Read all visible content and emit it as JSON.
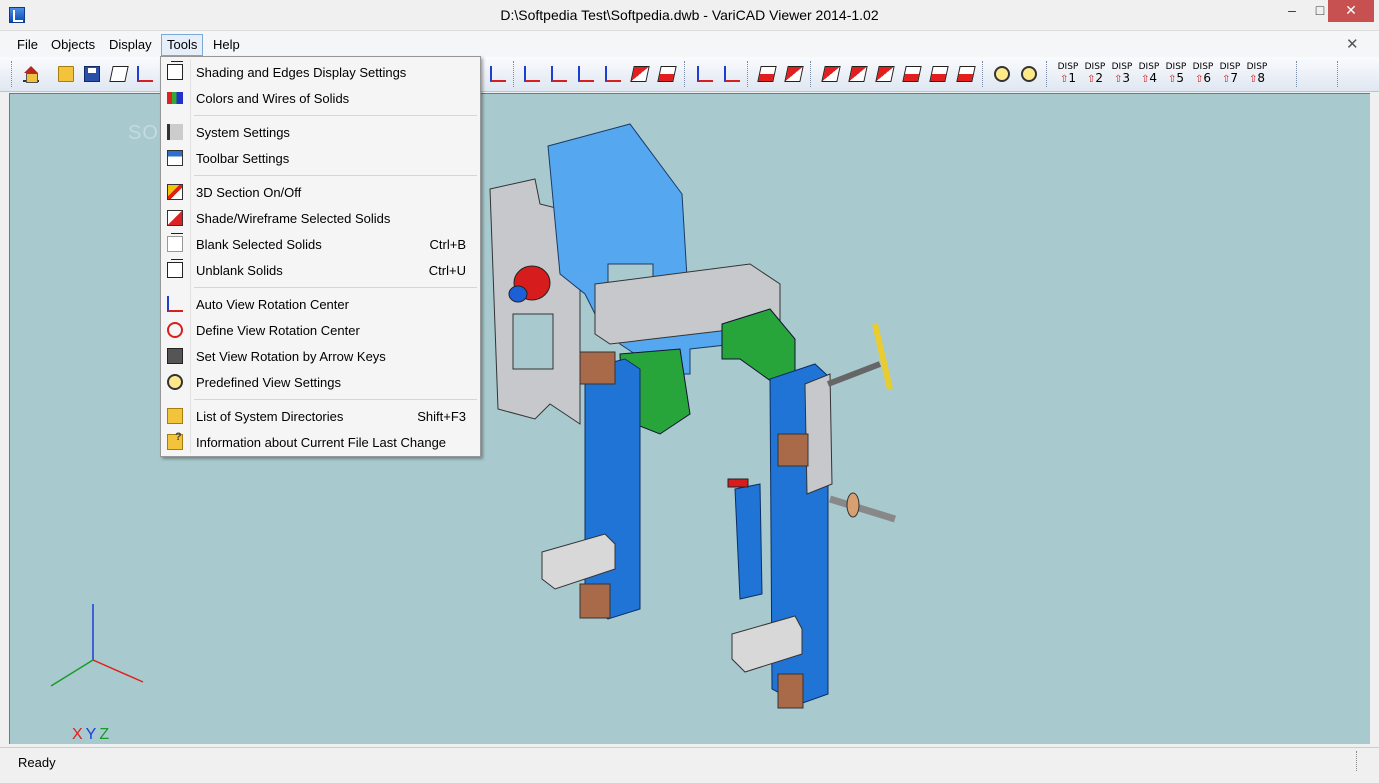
{
  "window": {
    "title": "D:\\Softpedia Test\\Softpedia.dwb - VariCAD Viewer 2014-1.02",
    "min_glyph": "–",
    "max_glyph": "□",
    "close_glyph": "✕"
  },
  "menu": {
    "items": [
      {
        "label": "File"
      },
      {
        "label": "Objects"
      },
      {
        "label": "Display"
      },
      {
        "label": "Tools"
      },
      {
        "label": "Help"
      }
    ],
    "active": "Tools",
    "mdi_close": "✕"
  },
  "toolbar": {
    "disp_prefix": "DISP",
    "disp_buttons": [
      "1",
      "2",
      "3",
      "4",
      "5",
      "6",
      "7",
      "8"
    ]
  },
  "tools_menu": {
    "items": [
      {
        "label": "Shading and Edges Display Settings",
        "shortcut": "",
        "icon": "cube-icon"
      },
      {
        "label": "Colors and Wires of Solids",
        "shortcut": "",
        "icon": "colors-icon"
      },
      {
        "label": "System Settings",
        "shortcut": "",
        "icon": "settings-icon"
      },
      {
        "label": "Toolbar Settings",
        "shortcut": "",
        "icon": "toolbar-icon"
      },
      {
        "label": "3D Section On/Off",
        "shortcut": "",
        "icon": "section-icon"
      },
      {
        "label": "Shade/Wireframe Selected Solids",
        "shortcut": "",
        "icon": "shade-icon"
      },
      {
        "label": "Blank Selected Solids",
        "shortcut": "Ctrl+B",
        "icon": "blank-cube-icon"
      },
      {
        "label": "Unblank Solids",
        "shortcut": "Ctrl+U",
        "icon": "cube-icon"
      },
      {
        "label": "Auto View Rotation Center",
        "shortcut": "",
        "icon": "axes-icon"
      },
      {
        "label": "Define View Rotation Center",
        "shortcut": "",
        "icon": "rotation-icon"
      },
      {
        "label": "Set View Rotation by Arrow Keys",
        "shortcut": "",
        "icon": "keys-icon"
      },
      {
        "label": "Predefined View Settings",
        "shortcut": "",
        "icon": "magnifier-icon"
      },
      {
        "label": "List of System Directories",
        "shortcut": "Shift+F3",
        "icon": "folder-icon"
      },
      {
        "label": "Information about Current File Last Change",
        "shortcut": "",
        "icon": "folder-question-icon"
      }
    ]
  },
  "viewport": {
    "background": "#a8cacf",
    "watermark": "SOFTPEDIA",
    "axes": {
      "x": "X",
      "y": "Y",
      "z": "Z"
    },
    "axis_colors": {
      "x": "#e0201c",
      "y": "#1a3fd8",
      "z": "#1a9a2a"
    }
  },
  "status": {
    "text": "Ready"
  }
}
